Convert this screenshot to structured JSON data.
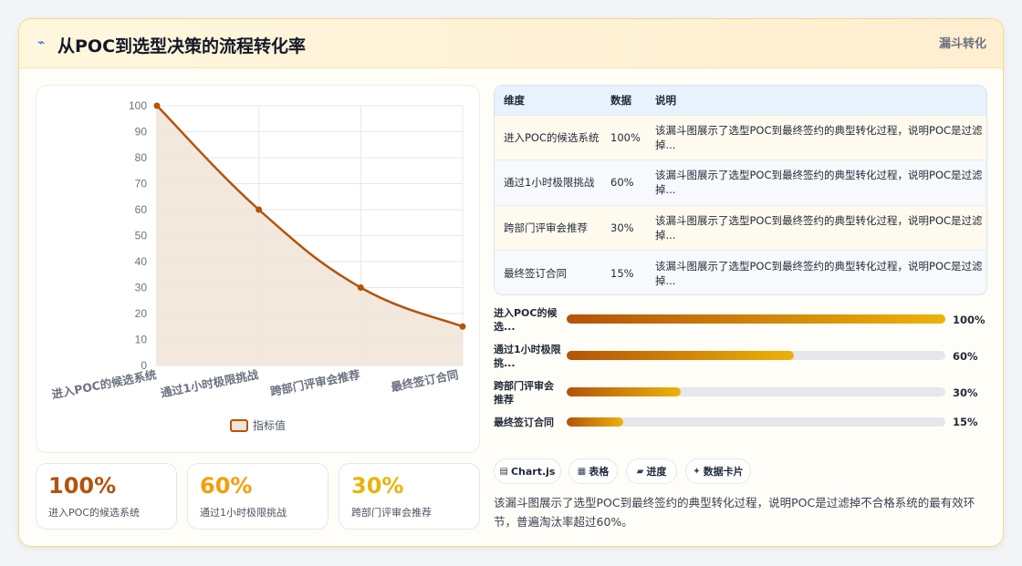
{
  "header": {
    "icon": "lightning-icon",
    "title": "从POC到选型决策的流程转化率",
    "tag": "漏斗转化"
  },
  "chart_data": {
    "type": "line",
    "categories": [
      "进入POC的候选系统",
      "通过1小时极限挑战",
      "跨部门评审会推荐",
      "最终签订合同"
    ],
    "series": [
      {
        "name": "指标值",
        "values": [
          100,
          60,
          30,
          15
        ]
      }
    ],
    "ylim": [
      0,
      100
    ],
    "yticks": [
      0,
      10,
      20,
      30,
      40,
      50,
      60,
      70,
      80,
      90,
      100
    ],
    "area_fill": true,
    "grid": true,
    "legend": "bottom",
    "colors": {
      "line": "#b45309",
      "fill": "#f1e4d8"
    }
  },
  "stats": [
    {
      "value": "100%",
      "label": "进入POC的候选系统",
      "color": "#b45309"
    },
    {
      "value": "60%",
      "label": "通过1小时极限挑战",
      "color": "#f59e0b"
    },
    {
      "value": "30%",
      "label": "跨部门评审会推荐",
      "color": "#eab308"
    }
  ],
  "table": {
    "headers": [
      "维度",
      "数据",
      "说明"
    ],
    "rows": [
      {
        "dim": "进入POC的候选系统",
        "data": "100%",
        "note": "该漏斗图展示了选型POC到最终签约的典型转化过程，说明POC是过滤掉..."
      },
      {
        "dim": "通过1小时极限挑战",
        "data": "60%",
        "note": "该漏斗图展示了选型POC到最终签约的典型转化过程，说明POC是过滤掉..."
      },
      {
        "dim": "跨部门评审会推荐",
        "data": "30%",
        "note": "该漏斗图展示了选型POC到最终签约的典型转化过程，说明POC是过滤掉..."
      },
      {
        "dim": "最终签订合同",
        "data": "15%",
        "note": "该漏斗图展示了选型POC到最终签约的典型转化过程，说明POC是过滤掉..."
      }
    ]
  },
  "progress": [
    {
      "label": "进入POC的候选...",
      "value": 100,
      "value_text": "100%"
    },
    {
      "label": "通过1小时极限挑...",
      "value": 60,
      "value_text": "60%"
    },
    {
      "label": "跨部门评审会推荐",
      "value": 30,
      "value_text": "30%"
    },
    {
      "label": "最终签订合同",
      "value": 15,
      "value_text": "15%"
    }
  ],
  "chips": [
    {
      "icon": "chart-icon",
      "glyph": "▤",
      "label": "Chart.js"
    },
    {
      "icon": "table-icon",
      "glyph": "▦",
      "label": "表格"
    },
    {
      "icon": "progress-icon",
      "glyph": "▰",
      "label": "进度"
    },
    {
      "icon": "sparkle-icon",
      "glyph": "✦",
      "label": "数据卡片"
    }
  ],
  "description": "该漏斗图展示了选型POC到最终签约的典型转化过程，说明POC是过滤掉不合格系统的最有效环节，普遍淘汰率超过60%。"
}
